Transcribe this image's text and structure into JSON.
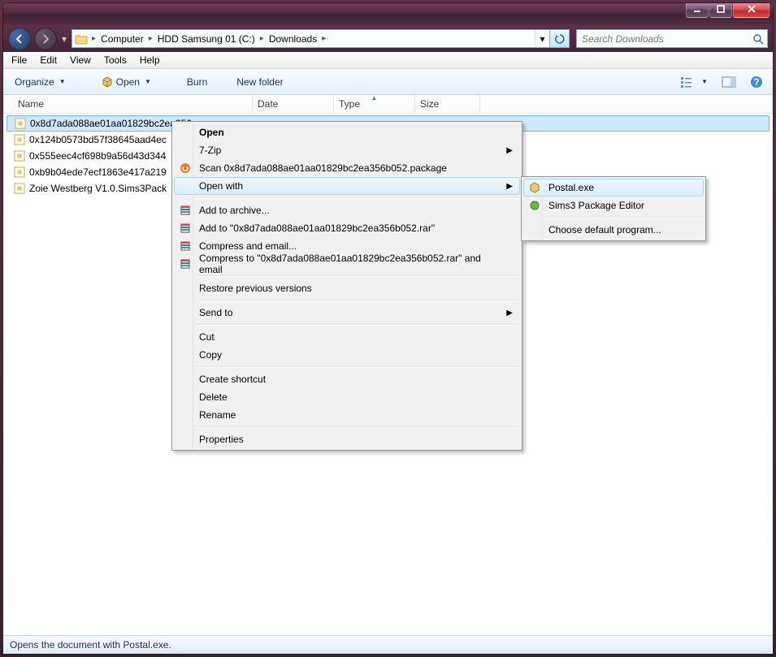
{
  "breadcrumbs": [
    "Computer",
    "HDD Samsung 01 (C:)",
    "Downloads"
  ],
  "search": {
    "placeholder": "Search Downloads"
  },
  "menubar": [
    "File",
    "Edit",
    "View",
    "Tools",
    "Help"
  ],
  "toolbar": {
    "organize": "Organize",
    "open": "Open",
    "burn": "Burn",
    "newfolder": "New folder"
  },
  "columns": {
    "name": "Name",
    "date": "Date",
    "type": "Type",
    "size": "Size"
  },
  "files": [
    "0x8d7ada088ae01aa01829bc2ea356b052.package",
    "0x124b0573bd57f38645aad4ec",
    "0x555eec4cf698b9a56d43d344",
    "0xb9b04ede7ecf1863e417a219",
    "Zoie Westberg V1.0.Sims3Pack"
  ],
  "selected_index": 0,
  "context": {
    "open": "Open",
    "sevenzip": "7-Zip",
    "scan": "Scan 0x8d7ada088ae01aa01829bc2ea356b052.package",
    "openwith": "Open with",
    "addarchive": "Add to archive...",
    "addto": "Add to \"0x8d7ada088ae01aa01829bc2ea356b052.rar\"",
    "compressemail": "Compress and email...",
    "compressto": "Compress to \"0x8d7ada088ae01aa01829bc2ea356b052.rar\" and email",
    "restore": "Restore previous versions",
    "sendto": "Send to",
    "cut": "Cut",
    "copy": "Copy",
    "shortcut": "Create shortcut",
    "delete": "Delete",
    "rename": "Rename",
    "properties": "Properties"
  },
  "submenu": {
    "postal": "Postal.exe",
    "s3pe": "Sims3 Package Editor",
    "default": "Choose default program..."
  },
  "status": "Opens the document with Postal.exe."
}
